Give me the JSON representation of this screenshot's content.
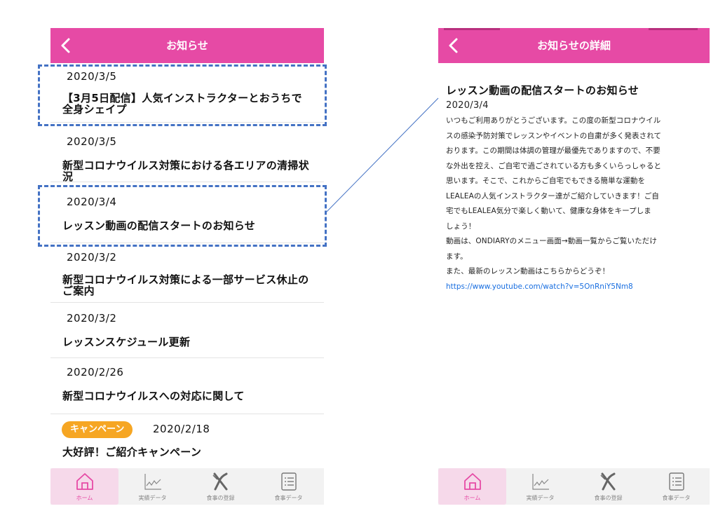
{
  "left": {
    "header": {
      "title": "お知らせ"
    },
    "news": [
      {
        "date": "2020/3/5",
        "title": "【3月5日配信】人気インストラクターとおうちで全身シェイプ"
      },
      {
        "date": "2020/3/5",
        "title": "新型コロナウイルス対策における各エリアの清掃状況"
      },
      {
        "date": "2020/3/4",
        "title": "レッスン動画の配信スタートのお知らせ"
      },
      {
        "date": "2020/3/2",
        "title": "新型コロナウイルス対策による一部サービス休止のご案内"
      },
      {
        "date": "2020/3/2",
        "title": "レッスンスケジュール更新"
      },
      {
        "date": "2020/2/26",
        "title": "新型コロナウイルスへの対応に関して"
      },
      {
        "date": "2020/2/18",
        "badge": "キャンペーン",
        "title": "大好評！ご紹介キャンペーン"
      }
    ]
  },
  "right": {
    "header": {
      "title": "お知らせの詳細"
    },
    "article": {
      "title": "レッスン動画の配信スタートのお知らせ",
      "date": "2020/3/4",
      "body": [
        "いつもご利用ありがとうございます。この度の新型コロナウイル",
        "スの感染予防対策でレッスンやイベントの自粛が多く発表されて",
        "おります。この期間は体調の管理が最優先でありますので、不要",
        "な外出を控え、ご自宅で過ごされている方も多くいらっしゃると",
        "思います。そこで、これからご自宅でもできる簡単な運動を",
        "LEALEAの人気インストラクター達がご紹介していきます！ご自",
        "宅でもLEALEA気分で楽しく動いて、健康な身体をキープしま",
        "しょう！",
        "動画は、ONDIARYのメニュー画面→動画一覧からご覧いただけ",
        "ます。",
        "また、最新のレッスン動画はこちらからどうぞ！"
      ],
      "link": "https://www.youtube.com/watch?v=5OnRniY5Nm8"
    }
  },
  "nav": {
    "home": "ホーム",
    "results": "実績データ",
    "meal_register": "食事の登録",
    "meal_data": "食事データ"
  },
  "colors": {
    "header": "#e64aa5",
    "badge": "#f6a623",
    "highlight": "#4472c4",
    "link": "#1a6fe0",
    "active_tab": "#f6d9ea"
  }
}
